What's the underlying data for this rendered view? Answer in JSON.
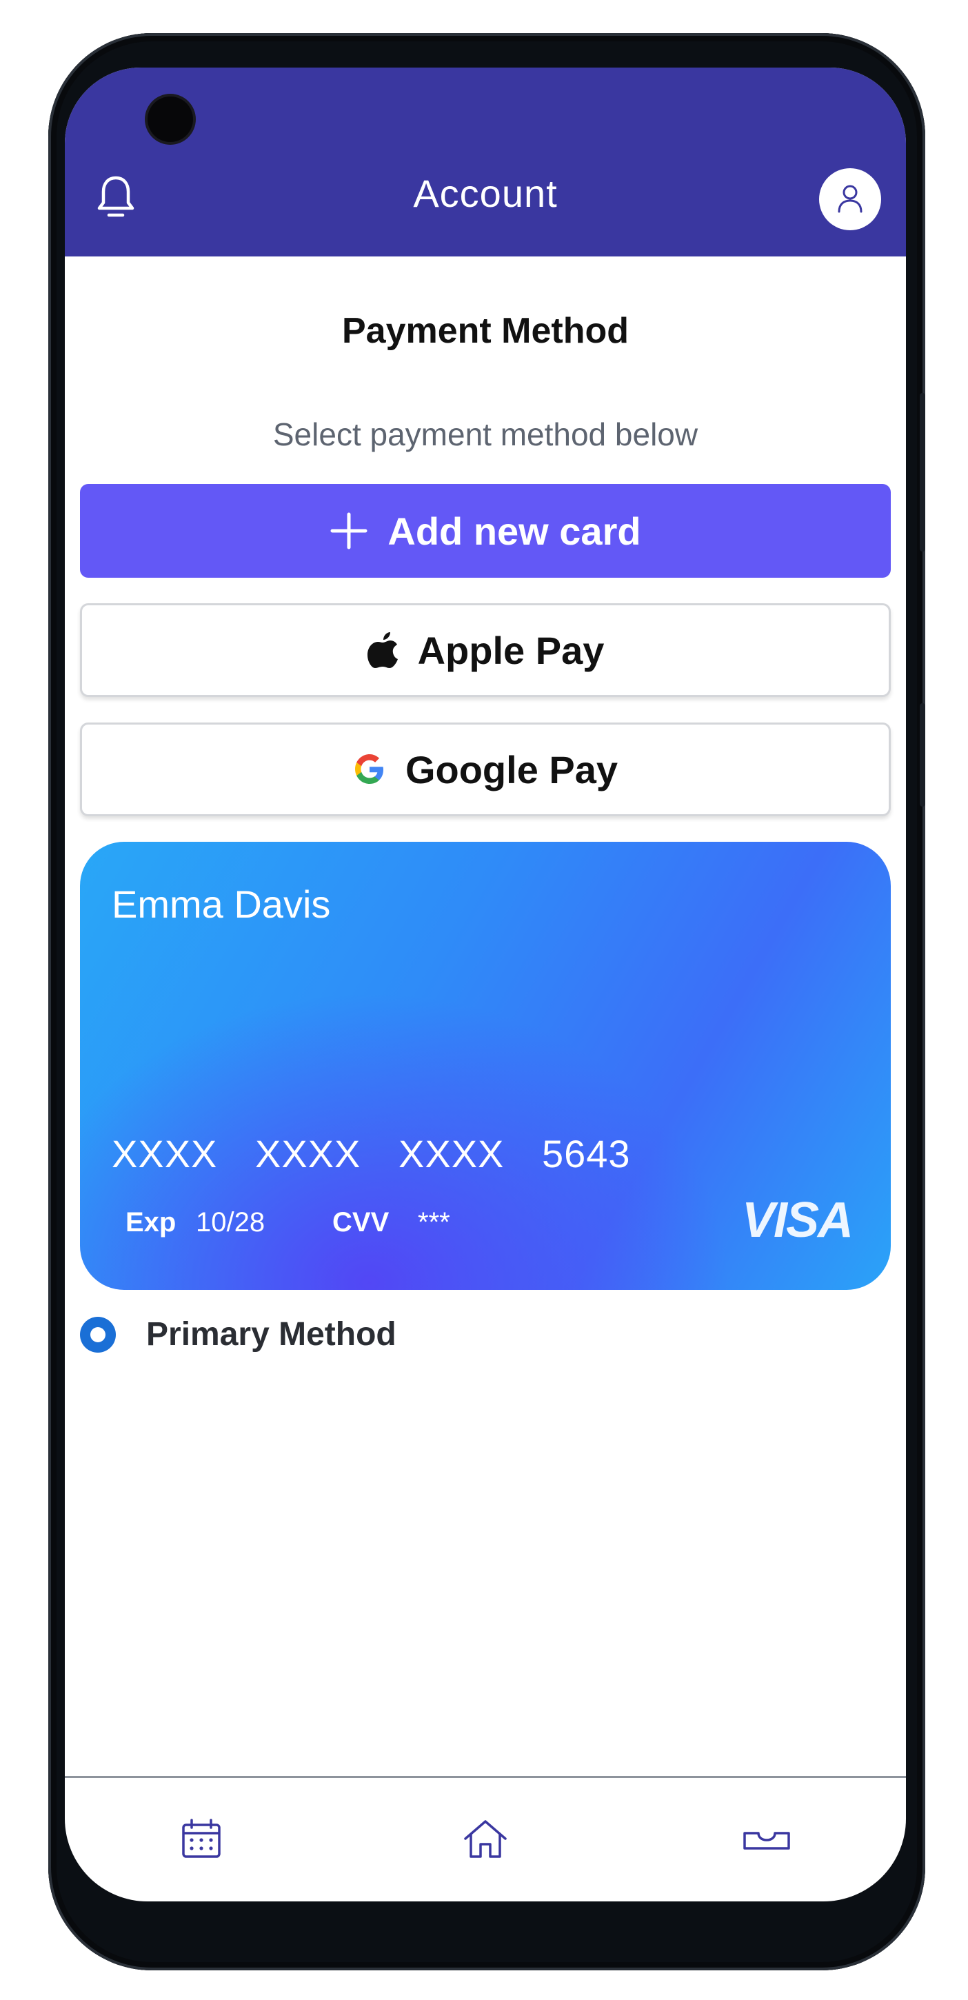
{
  "header": {
    "title": "Account",
    "icons": [
      "bell-icon",
      "user-icon"
    ],
    "color": "#3a37a0"
  },
  "payment": {
    "heading": "Payment Method",
    "subheading": "Select payment method below",
    "add_card_label": "Add new card",
    "apple_pay_label": "Apple Pay",
    "google_pay_label": "Google Pay",
    "accent_color": "#6358f6"
  },
  "card": {
    "holder": "Emma Davis",
    "number_groups": [
      "XXXX",
      "XXXX",
      "XXXX",
      "5643"
    ],
    "exp_label": "Exp",
    "exp_value": "10/28",
    "cvv_label": "CVV",
    "cvv_value": "***",
    "brand": "VISA"
  },
  "primary": {
    "label": "Primary Method",
    "selected": true
  },
  "bottom_nav": {
    "items": [
      "calendar-icon",
      "home-icon",
      "inbox-icon"
    ]
  }
}
